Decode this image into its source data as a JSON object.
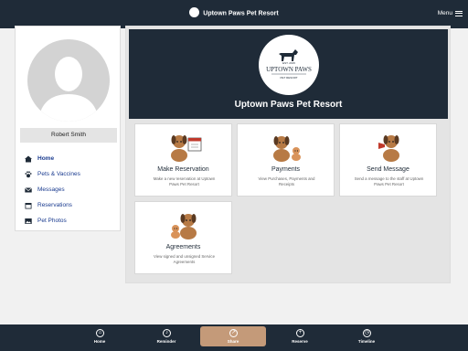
{
  "header": {
    "title": "Uptown Paws Pet Resort",
    "menu_label": "Menu"
  },
  "profile": {
    "name": "Robert Smith"
  },
  "sidebar": {
    "items": [
      {
        "label": "Home",
        "icon": "home-icon",
        "active": true
      },
      {
        "label": "Pets & Vaccines",
        "icon": "paw-icon"
      },
      {
        "label": "Messages",
        "icon": "envelope-icon"
      },
      {
        "label": "Reservations",
        "icon": "calendar-icon"
      },
      {
        "label": "Pet Photos",
        "icon": "photo-icon"
      }
    ]
  },
  "hero": {
    "title": "Uptown Paws Pet Resort",
    "logo": {
      "top": "EST. 2015",
      "main": "UPTOWN PAWS",
      "bottom": "PET RESORT"
    }
  },
  "cards": [
    {
      "title": "Make Reservation",
      "desc": "Make a new reservation at Uptown Paws Pet Resort"
    },
    {
      "title": "Payments",
      "desc": "View Purchases, Payments and Receipts"
    },
    {
      "title": "Send Message",
      "desc": "Send a message to the staff at Uptown Paws Pet Resort"
    },
    {
      "title": "Agreements",
      "desc": "View signed and unsigned Service Agreements"
    }
  ],
  "bottom_nav": {
    "tabs": [
      {
        "label": "Home",
        "icon": "home-icon"
      },
      {
        "label": "Reminder",
        "icon": "bell-icon"
      },
      {
        "label": "Share",
        "icon": "share-icon",
        "active": true
      },
      {
        "label": "Reserve",
        "icon": "plus-icon"
      },
      {
        "label": "Timeline",
        "icon": "clock-icon"
      }
    ]
  },
  "colors": {
    "navy": "#1f2b38",
    "accent": "#c49a79",
    "link": "#1a3b8f",
    "dog": "#b77a45"
  }
}
